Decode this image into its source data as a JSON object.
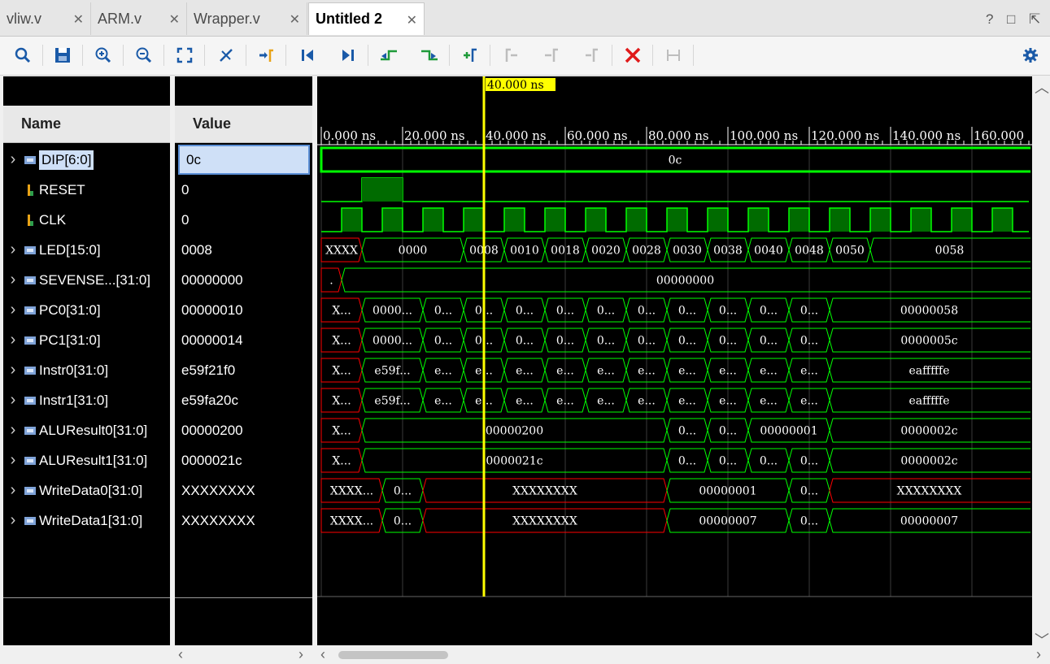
{
  "tabs": [
    {
      "label": "vliw.v",
      "active": false
    },
    {
      "label": "ARM.v",
      "active": false
    },
    {
      "label": "Wrapper.v",
      "active": false
    },
    {
      "label": "Untitled 2",
      "active": true
    }
  ],
  "window_controls": {
    "help": "?",
    "restore": "□",
    "maximize": "⇱"
  },
  "toolbar_icons": [
    "search-icon",
    "save-icon",
    "zoom-in-icon",
    "zoom-out-icon",
    "zoom-fit-icon",
    "cursor-to-zero-icon",
    "go-to-cursor-icon",
    "go-to-start-icon",
    "go-to-end-icon",
    "previous-transition-icon",
    "next-transition-icon",
    "add-marker-icon",
    "previous-marker-icon",
    "next-marker-icon",
    "remove-marker-icon",
    "delete-markers-icon",
    "swap-cursors-icon",
    "settings-icon"
  ],
  "headers": {
    "name": "Name",
    "value": "Value"
  },
  "cursor_label": "40.000 ns",
  "time_ticks": [
    "0.000 ns",
    "20.000 ns",
    "40.000 ns",
    "60.000 ns",
    "80.000 ns",
    "100.000 ns",
    "120.000 ns",
    "140.000 ns",
    "160.000"
  ],
  "signals": [
    {
      "name": "DIP[6:0]",
      "value": "0c",
      "expandable": true,
      "icon": "bus-icon",
      "selected": true
    },
    {
      "name": "RESET",
      "value": "0",
      "expandable": false,
      "icon": "bit-icon"
    },
    {
      "name": "CLK",
      "value": "0",
      "expandable": false,
      "icon": "bit-icon"
    },
    {
      "name": "LED[15:0]",
      "value": "0008",
      "expandable": true,
      "icon": "bus-icon"
    },
    {
      "name": "SEVENSE...[31:0]",
      "value": "00000000",
      "expandable": true,
      "icon": "bus-icon"
    },
    {
      "name": "PC0[31:0]",
      "value": "00000010",
      "expandable": true,
      "icon": "bus-icon"
    },
    {
      "name": "PC1[31:0]",
      "value": "00000014",
      "expandable": true,
      "icon": "bus-icon"
    },
    {
      "name": "Instr0[31:0]",
      "value": "e59f21f0",
      "expandable": true,
      "icon": "bus-icon"
    },
    {
      "name": "Instr1[31:0]",
      "value": "e59fa20c",
      "expandable": true,
      "icon": "bus-icon"
    },
    {
      "name": "ALUResult0[31:0]",
      "value": "00000200",
      "expandable": true,
      "icon": "bus-icon"
    },
    {
      "name": "ALUResult1[31:0]",
      "value": "0000021c",
      "expandable": true,
      "icon": "bus-icon"
    },
    {
      "name": "WriteData0[31:0]",
      "value": "XXXXXXXX",
      "expandable": true,
      "icon": "bus-icon"
    },
    {
      "name": "WriteData1[31:0]",
      "value": "XXXXXXXX",
      "expandable": true,
      "icon": "bus-icon"
    }
  ],
  "waves": {
    "time_range_ns": [
      0,
      174
    ],
    "cursor_ns": 40,
    "clk_period_ns": 10,
    "reset_high_ns": [
      10,
      20
    ],
    "buses": [
      [
        {
          "t0": 0,
          "t1": 174,
          "label": "0c",
          "x": false
        }
      ],
      null,
      null,
      [
        {
          "t0": 0,
          "t1": 10,
          "label": "XXXX",
          "x": true
        },
        {
          "t0": 10,
          "t1": 35,
          "label": "0000"
        },
        {
          "t0": 35,
          "t1": 45,
          "label": "0008"
        },
        {
          "t0": 45,
          "t1": 55,
          "label": "0010"
        },
        {
          "t0": 55,
          "t1": 65,
          "label": "0018"
        },
        {
          "t0": 65,
          "t1": 75,
          "label": "0020"
        },
        {
          "t0": 75,
          "t1": 85,
          "label": "0028"
        },
        {
          "t0": 85,
          "t1": 95,
          "label": "0030"
        },
        {
          "t0": 95,
          "t1": 105,
          "label": "0038"
        },
        {
          "t0": 105,
          "t1": 115,
          "label": "0040"
        },
        {
          "t0": 115,
          "t1": 125,
          "label": "0048"
        },
        {
          "t0": 125,
          "t1": 135,
          "label": "0050"
        },
        {
          "t0": 135,
          "t1": 174,
          "label": "0058"
        }
      ],
      [
        {
          "t0": 0,
          "t1": 5,
          "label": ".",
          "x": true
        },
        {
          "t0": 5,
          "t1": 174,
          "label": "00000000"
        }
      ],
      [
        {
          "t0": 0,
          "t1": 10,
          "label": "X...",
          "x": true
        },
        {
          "t0": 10,
          "t1": 25,
          "label": "0000..."
        },
        {
          "t0": 25,
          "t1": 35,
          "label": "0..."
        },
        {
          "t0": 35,
          "t1": 45,
          "label": "0..."
        },
        {
          "t0": 45,
          "t1": 55,
          "label": "0..."
        },
        {
          "t0": 55,
          "t1": 65,
          "label": "0..."
        },
        {
          "t0": 65,
          "t1": 75,
          "label": "0..."
        },
        {
          "t0": 75,
          "t1": 85,
          "label": "0..."
        },
        {
          "t0": 85,
          "t1": 95,
          "label": "0..."
        },
        {
          "t0": 95,
          "t1": 105,
          "label": "0..."
        },
        {
          "t0": 105,
          "t1": 115,
          "label": "0..."
        },
        {
          "t0": 115,
          "t1": 125,
          "label": "0..."
        },
        {
          "t0": 125,
          "t1": 174,
          "label": "00000058"
        }
      ],
      [
        {
          "t0": 0,
          "t1": 10,
          "label": "X...",
          "x": true
        },
        {
          "t0": 10,
          "t1": 25,
          "label": "0000..."
        },
        {
          "t0": 25,
          "t1": 35,
          "label": "0..."
        },
        {
          "t0": 35,
          "t1": 45,
          "label": "0..."
        },
        {
          "t0": 45,
          "t1": 55,
          "label": "0..."
        },
        {
          "t0": 55,
          "t1": 65,
          "label": "0..."
        },
        {
          "t0": 65,
          "t1": 75,
          "label": "0..."
        },
        {
          "t0": 75,
          "t1": 85,
          "label": "0..."
        },
        {
          "t0": 85,
          "t1": 95,
          "label": "0..."
        },
        {
          "t0": 95,
          "t1": 105,
          "label": "0..."
        },
        {
          "t0": 105,
          "t1": 115,
          "label": "0..."
        },
        {
          "t0": 115,
          "t1": 125,
          "label": "0..."
        },
        {
          "t0": 125,
          "t1": 174,
          "label": "0000005c"
        }
      ],
      [
        {
          "t0": 0,
          "t1": 10,
          "label": "X...",
          "x": true
        },
        {
          "t0": 10,
          "t1": 25,
          "label": "e59f..."
        },
        {
          "t0": 25,
          "t1": 35,
          "label": "e..."
        },
        {
          "t0": 35,
          "t1": 45,
          "label": "e..."
        },
        {
          "t0": 45,
          "t1": 55,
          "label": "e..."
        },
        {
          "t0": 55,
          "t1": 65,
          "label": "e..."
        },
        {
          "t0": 65,
          "t1": 75,
          "label": "e..."
        },
        {
          "t0": 75,
          "t1": 85,
          "label": "e..."
        },
        {
          "t0": 85,
          "t1": 95,
          "label": "e..."
        },
        {
          "t0": 95,
          "t1": 105,
          "label": "e..."
        },
        {
          "t0": 105,
          "t1": 115,
          "label": "e..."
        },
        {
          "t0": 115,
          "t1": 125,
          "label": "e..."
        },
        {
          "t0": 125,
          "t1": 174,
          "label": "eafffffe"
        }
      ],
      [
        {
          "t0": 0,
          "t1": 10,
          "label": "X...",
          "x": true
        },
        {
          "t0": 10,
          "t1": 25,
          "label": "e59f..."
        },
        {
          "t0": 25,
          "t1": 35,
          "label": "e..."
        },
        {
          "t0": 35,
          "t1": 45,
          "label": "e..."
        },
        {
          "t0": 45,
          "t1": 55,
          "label": "e..."
        },
        {
          "t0": 55,
          "t1": 65,
          "label": "e..."
        },
        {
          "t0": 65,
          "t1": 75,
          "label": "e..."
        },
        {
          "t0": 75,
          "t1": 85,
          "label": "e..."
        },
        {
          "t0": 85,
          "t1": 95,
          "label": "e..."
        },
        {
          "t0": 95,
          "t1": 105,
          "label": "e..."
        },
        {
          "t0": 105,
          "t1": 115,
          "label": "e..."
        },
        {
          "t0": 115,
          "t1": 125,
          "label": "e..."
        },
        {
          "t0": 125,
          "t1": 174,
          "label": "eafffffe"
        }
      ],
      [
        {
          "t0": 0,
          "t1": 10,
          "label": "X...",
          "x": true
        },
        {
          "t0": 10,
          "t1": 85,
          "label": "00000200"
        },
        {
          "t0": 85,
          "t1": 95,
          "label": "0..."
        },
        {
          "t0": 95,
          "t1": 105,
          "label": "0..."
        },
        {
          "t0": 105,
          "t1": 125,
          "label": "00000001"
        },
        {
          "t0": 125,
          "t1": 174,
          "label": "0000002c"
        }
      ],
      [
        {
          "t0": 0,
          "t1": 10,
          "label": "X...",
          "x": true
        },
        {
          "t0": 10,
          "t1": 85,
          "label": "0000021c"
        },
        {
          "t0": 85,
          "t1": 95,
          "label": "0..."
        },
        {
          "t0": 95,
          "t1": 105,
          "label": "0..."
        },
        {
          "t0": 105,
          "t1": 115,
          "label": "0..."
        },
        {
          "t0": 115,
          "t1": 125,
          "label": "0..."
        },
        {
          "t0": 125,
          "t1": 174,
          "label": "0000002c"
        }
      ],
      [
        {
          "t0": 0,
          "t1": 15,
          "label": "XXXX...",
          "x": true
        },
        {
          "t0": 15,
          "t1": 25,
          "label": "0..."
        },
        {
          "t0": 25,
          "t1": 85,
          "label": "XXXXXXXX",
          "x": true
        },
        {
          "t0": 85,
          "t1": 115,
          "label": "00000001"
        },
        {
          "t0": 115,
          "t1": 125,
          "label": "0..."
        },
        {
          "t0": 125,
          "t1": 174,
          "label": "XXXXXXXX",
          "x": true
        }
      ],
      [
        {
          "t0": 0,
          "t1": 15,
          "label": "XXXX...",
          "x": true
        },
        {
          "t0": 15,
          "t1": 25,
          "label": "0..."
        },
        {
          "t0": 25,
          "t1": 85,
          "label": "XXXXXXXX",
          "x": true
        },
        {
          "t0": 85,
          "t1": 115,
          "label": "00000007"
        },
        {
          "t0": 115,
          "t1": 125,
          "label": "0..."
        },
        {
          "t0": 125,
          "t1": 174,
          "label": "00000007"
        }
      ]
    ]
  },
  "colors": {
    "wave": "#00ff00",
    "wave_fill": "#006b00",
    "x_value": "#ff0000",
    "cursor": "#ffff00",
    "grid": "#3a3a3a",
    "tick_text": "#ffffff",
    "selection": "#cfe0f7"
  }
}
